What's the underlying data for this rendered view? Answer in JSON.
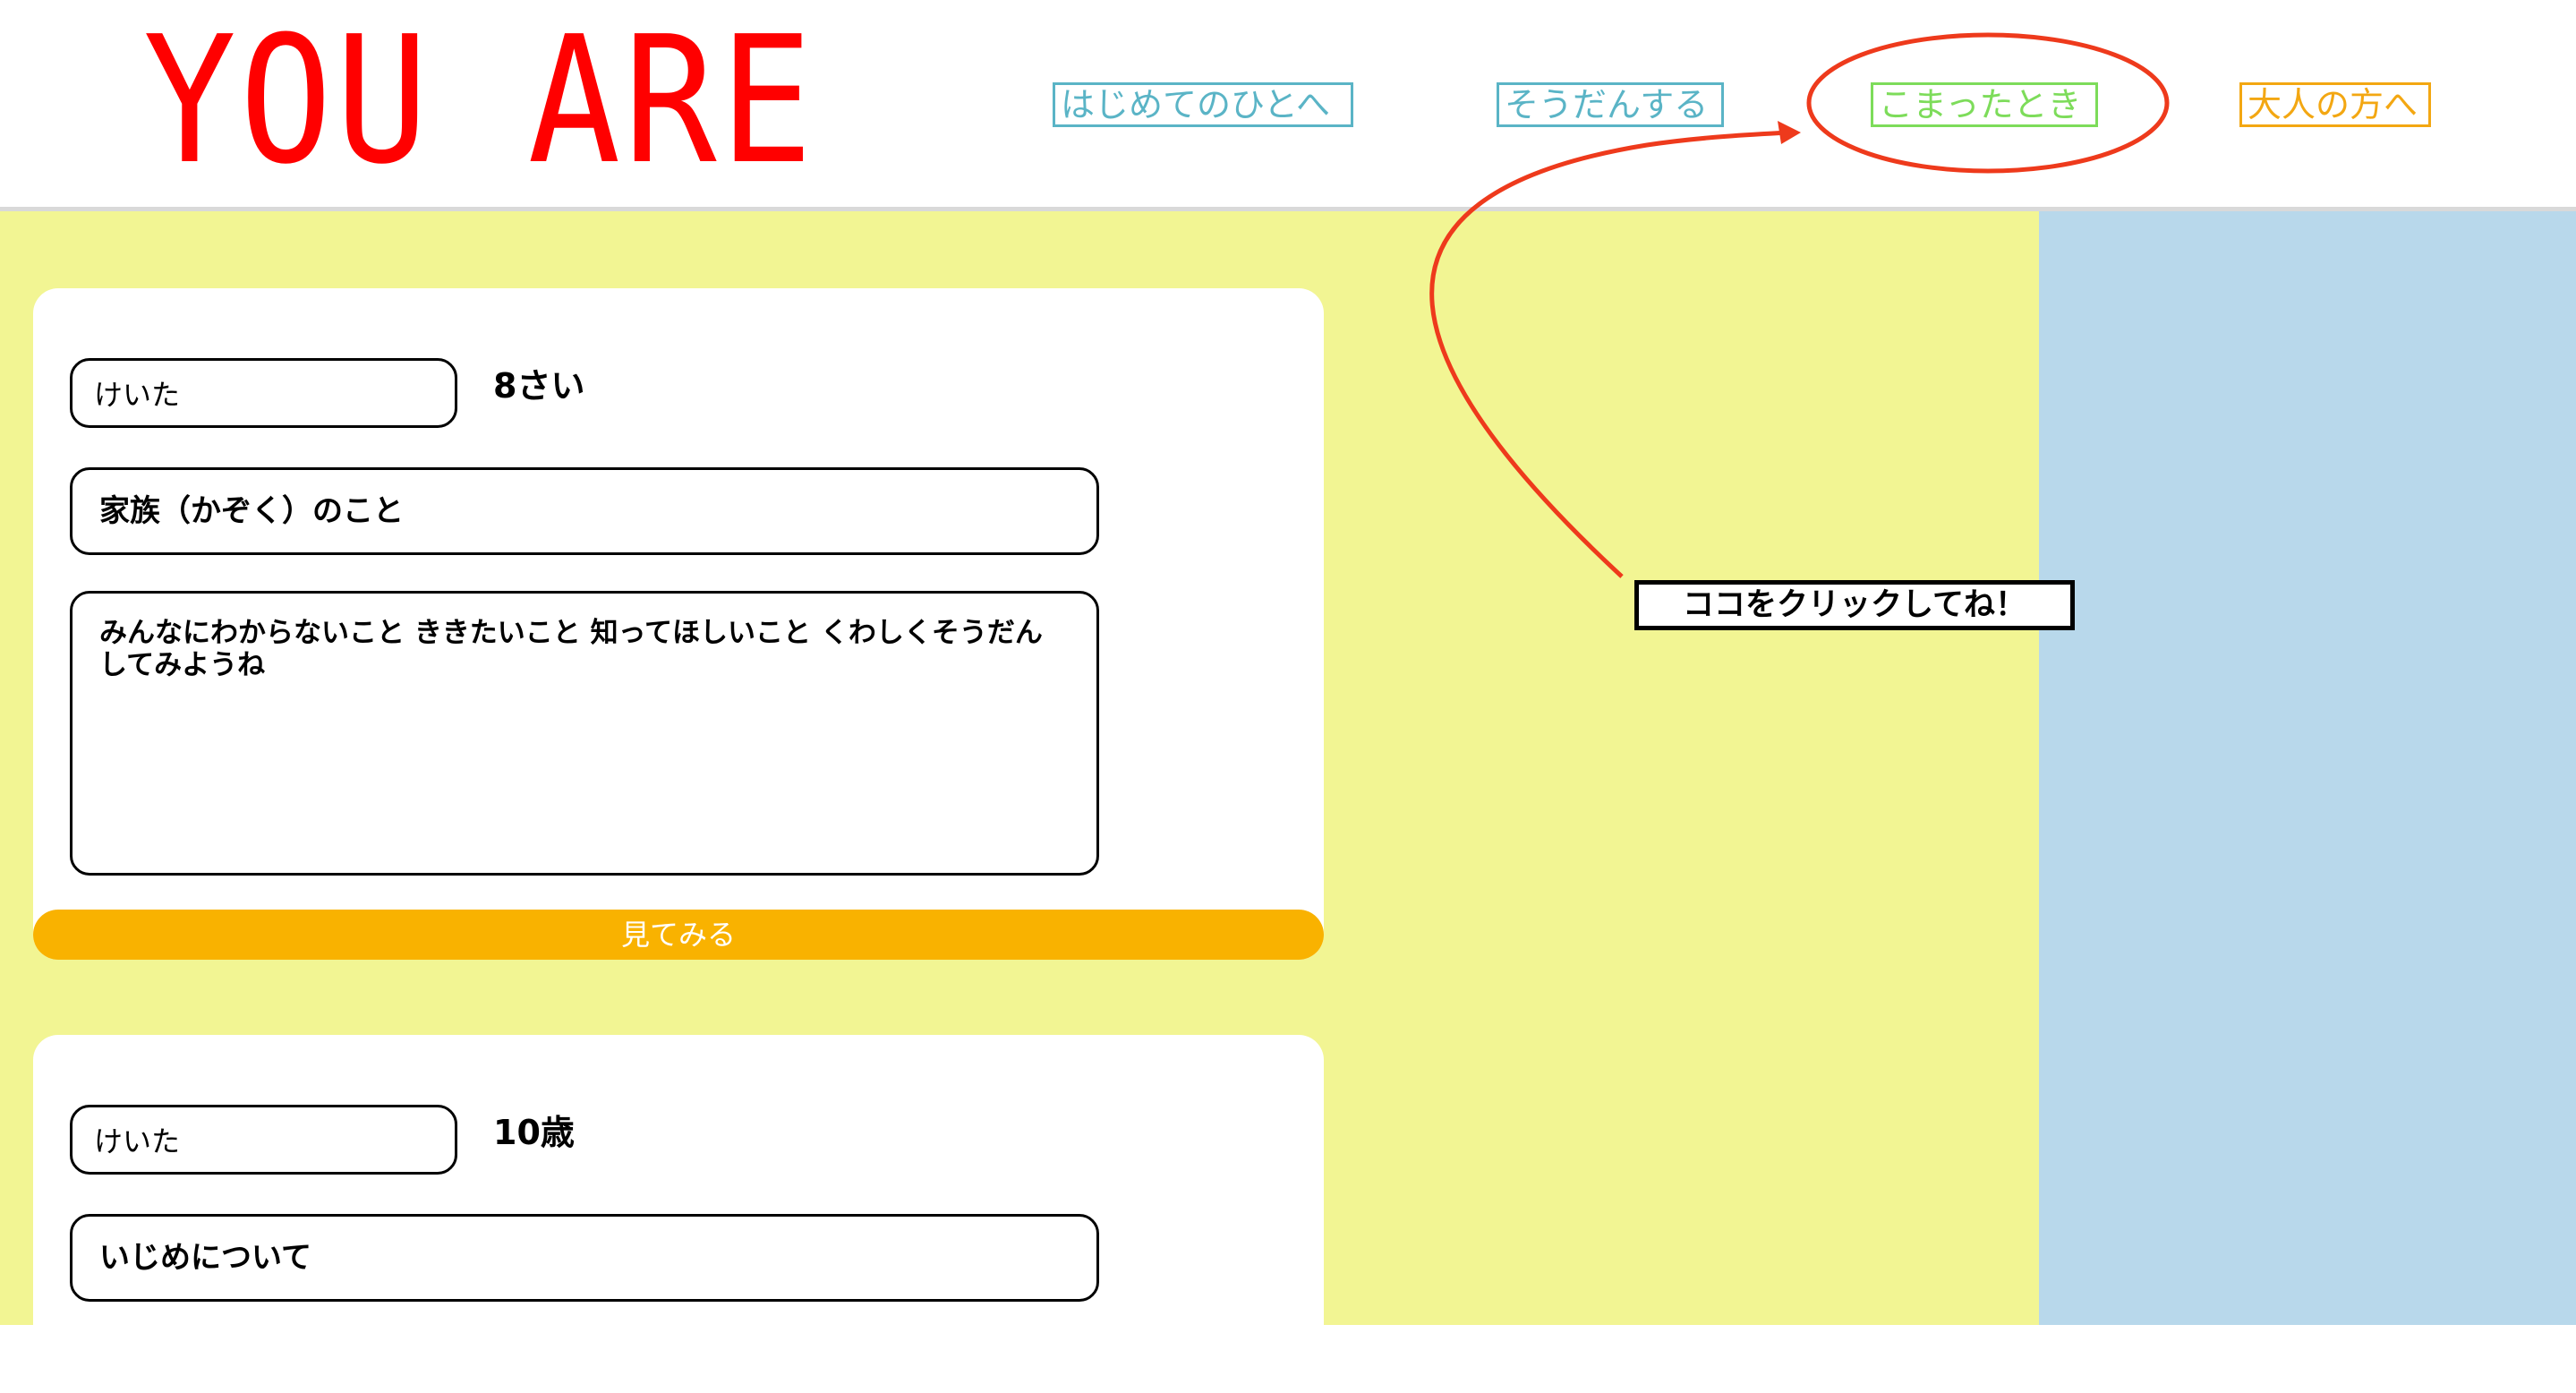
{
  "header": {
    "logo": "YOU ARE",
    "nav": [
      {
        "label": "はじめてのひとへ",
        "color": "#5ab4c6"
      },
      {
        "label": "そうだんする",
        "color": "#5ab4c6"
      },
      {
        "label": "こまったとき",
        "color": "#7ddc5a"
      },
      {
        "label": "大人の方へ",
        "color": "#f3a712"
      }
    ]
  },
  "posts": [
    {
      "name": "けいた",
      "age": "8さい",
      "topic": "家族（かぞく）のこと",
      "message": "みんなにわからないこと ききたいこと 知ってほしいこと くわしくそうだんしてみようね",
      "button": "見てみる"
    },
    {
      "name": "けいた",
      "age": "10歳",
      "topic": "いじめについて"
    }
  ],
  "annotation": {
    "hint": "ココをクリックしてね！",
    "color": "#ee3a1c"
  },
  "colors": {
    "main_bg": "#f2f593",
    "side_bg": "#b8d8eb",
    "button": "#f9b200",
    "logo": "#ff0000"
  }
}
